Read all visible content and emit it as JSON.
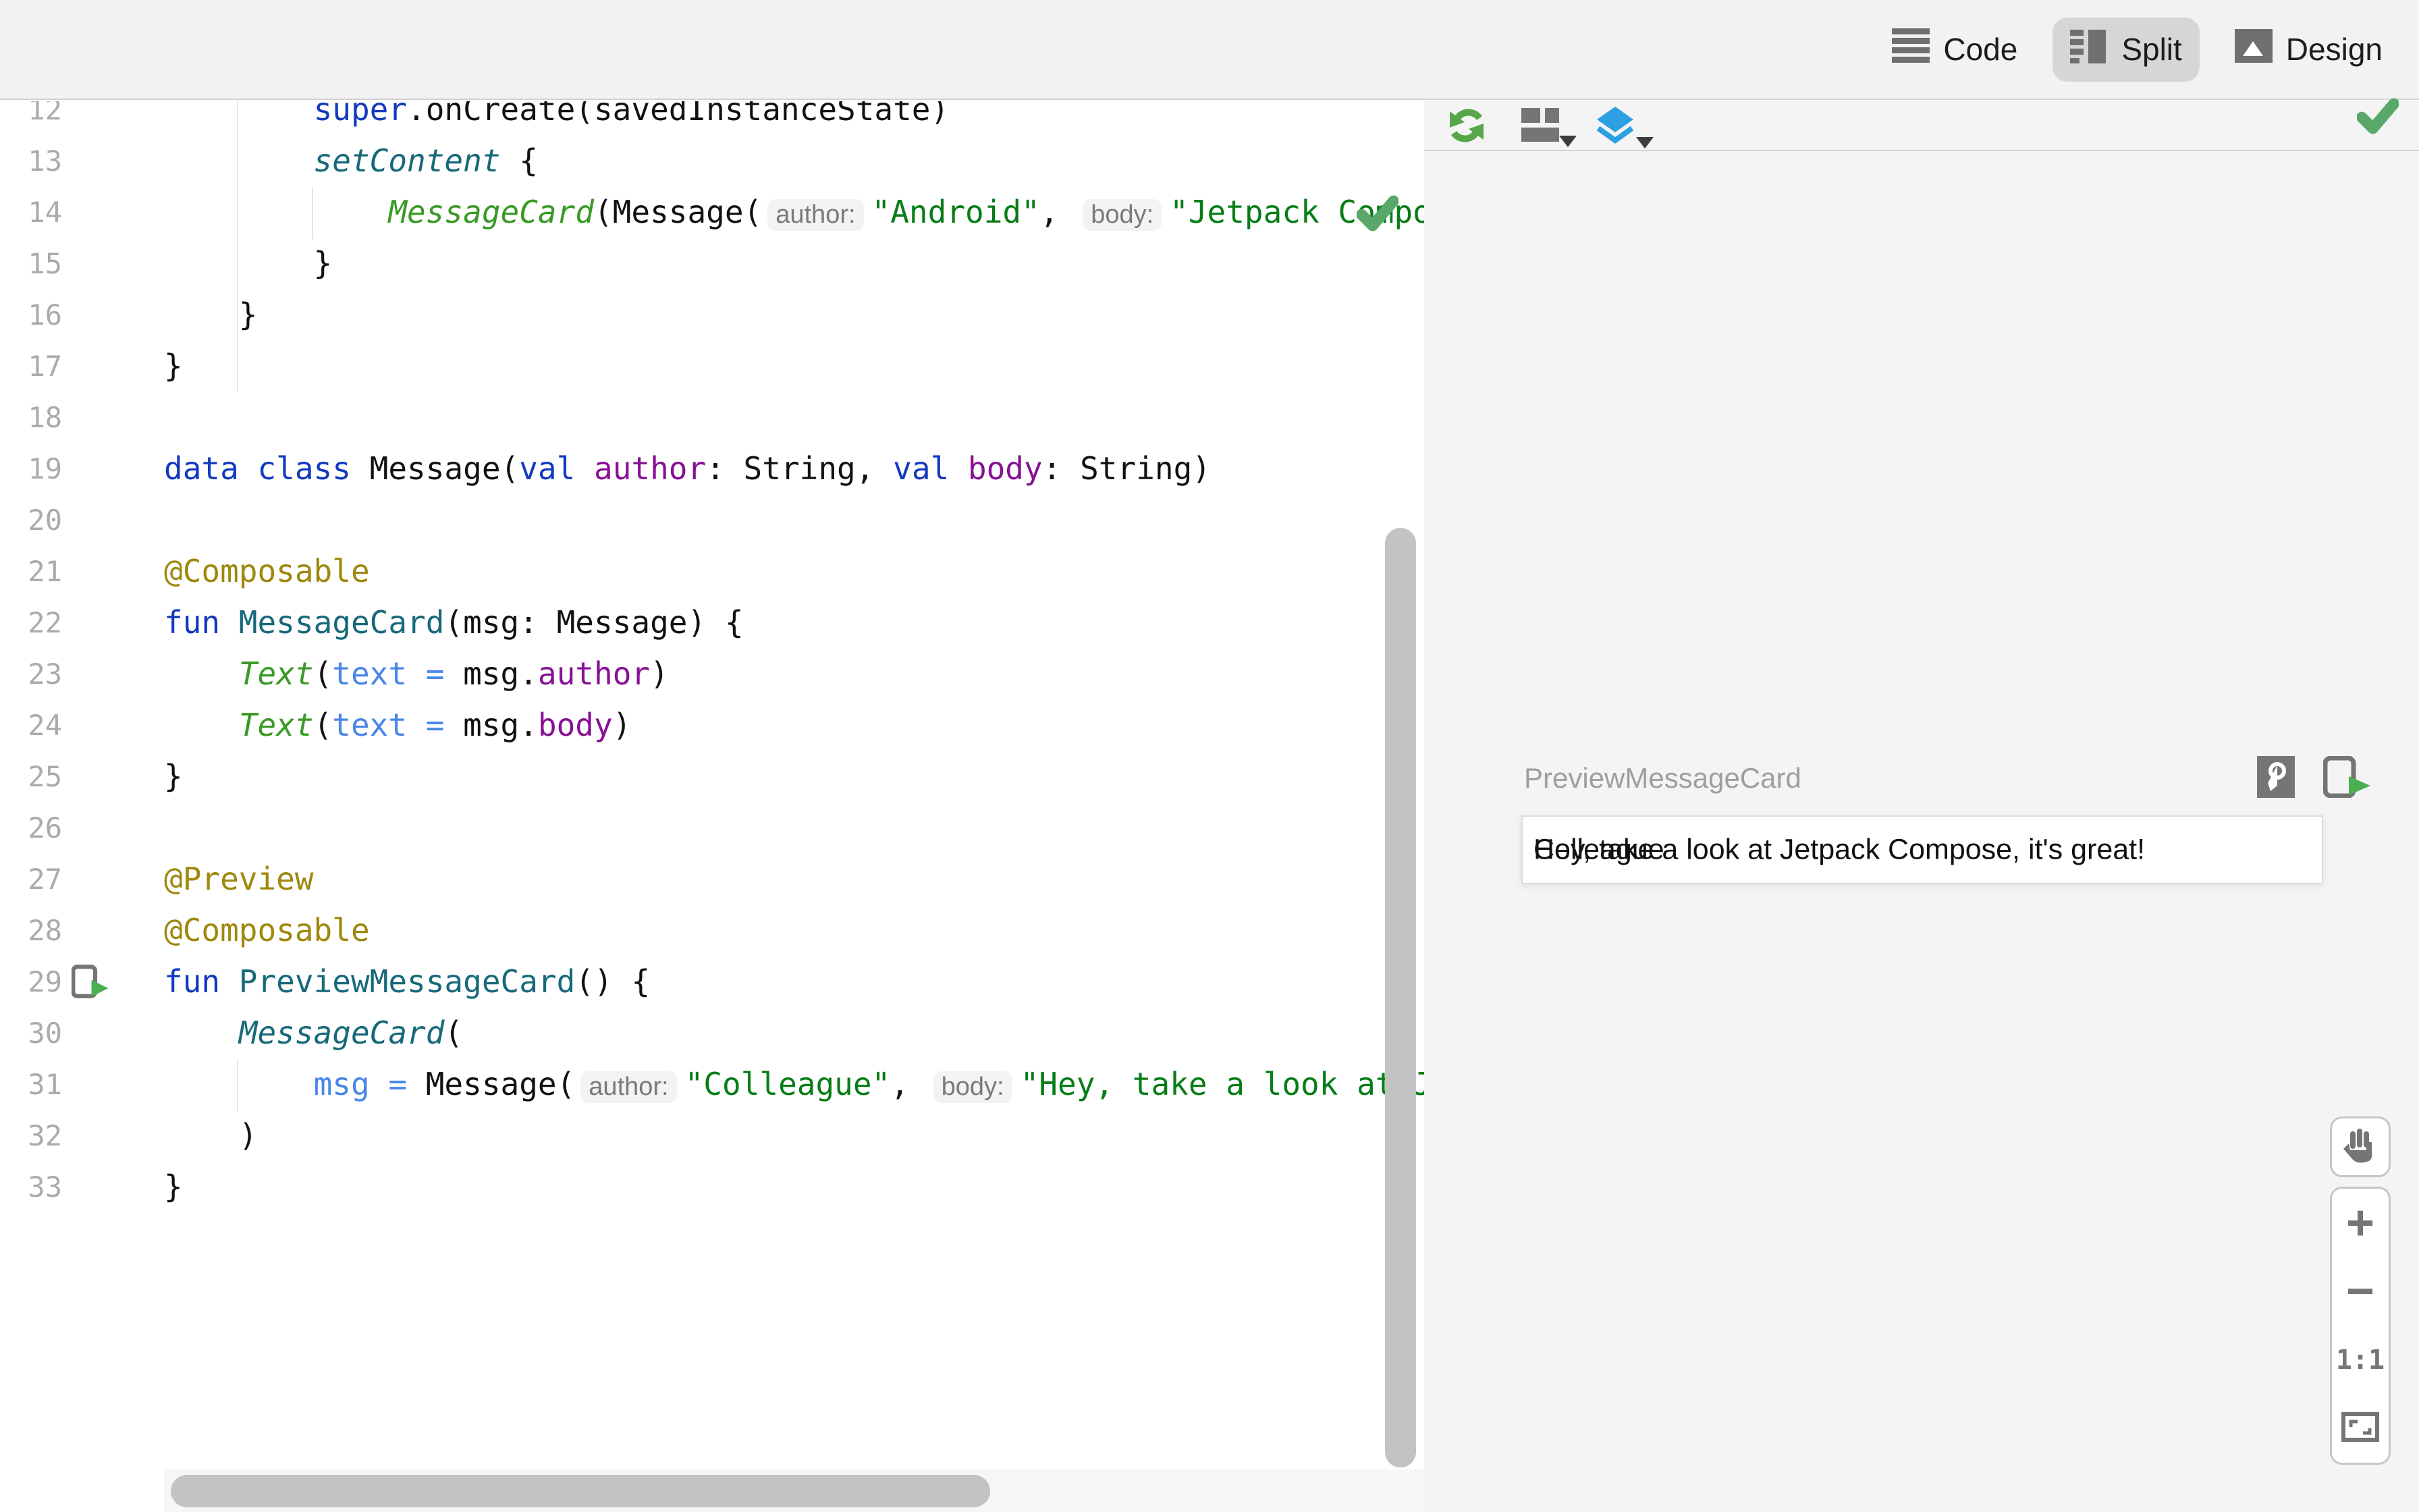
{
  "topbar": {
    "modes": [
      {
        "label": "Code",
        "icon": "code-view-icon",
        "active": false
      },
      {
        "label": "Split",
        "icon": "split-view-icon",
        "active": true
      },
      {
        "label": "Design",
        "icon": "design-view-icon",
        "active": false
      }
    ]
  },
  "editor": {
    "status_icon": "no-problems-check-icon",
    "lines": [
      {
        "n": 12,
        "tokens": [
          {
            "c": "pl",
            "t": "        "
          },
          {
            "c": "kw",
            "t": "super"
          },
          {
            "c": "pl",
            "t": ".onCreate(savedInstanceState)"
          }
        ]
      },
      {
        "n": 13,
        "tokens": [
          {
            "c": "pl",
            "t": "        "
          },
          {
            "c": "fni",
            "t": "setContent"
          },
          {
            "c": "pl",
            "t": " {"
          }
        ]
      },
      {
        "n": 14,
        "tokens": [
          {
            "c": "pl",
            "t": "            "
          },
          {
            "c": "comp",
            "t": "MessageCard"
          },
          {
            "c": "pl",
            "t": "(Message("
          },
          {
            "c": "hint",
            "t": "author:"
          },
          {
            "c": "str",
            "t": "\"Android\""
          },
          {
            "c": "pl",
            "t": ", "
          },
          {
            "c": "hint",
            "t": "body:"
          },
          {
            "c": "str",
            "t": "\"Jetpack Compose\""
          }
        ]
      },
      {
        "n": 15,
        "tokens": [
          {
            "c": "pl",
            "t": "        }"
          }
        ]
      },
      {
        "n": 16,
        "tokens": [
          {
            "c": "pl",
            "t": "    }"
          }
        ]
      },
      {
        "n": 17,
        "tokens": [
          {
            "c": "pl",
            "t": "}"
          }
        ]
      },
      {
        "n": 18,
        "tokens": []
      },
      {
        "n": 19,
        "tokens": [
          {
            "c": "kw",
            "t": "data class"
          },
          {
            "c": "pl",
            "t": " Message("
          },
          {
            "c": "kw",
            "t": "val"
          },
          {
            "c": "pl",
            "t": " "
          },
          {
            "c": "prop",
            "t": "author"
          },
          {
            "c": "pl",
            "t": ": String, "
          },
          {
            "c": "kw",
            "t": "val"
          },
          {
            "c": "pl",
            "t": " "
          },
          {
            "c": "prop",
            "t": "body"
          },
          {
            "c": "pl",
            "t": ": String)"
          }
        ]
      },
      {
        "n": 20,
        "tokens": []
      },
      {
        "n": 21,
        "tokens": [
          {
            "c": "ann",
            "t": "@Composable"
          }
        ]
      },
      {
        "n": 22,
        "tokens": [
          {
            "c": "kw",
            "t": "fun"
          },
          {
            "c": "pl",
            "t": " "
          },
          {
            "c": "fn",
            "t": "MessageCard"
          },
          {
            "c": "pl",
            "t": "(msg: Message) {"
          }
        ]
      },
      {
        "n": 23,
        "tokens": [
          {
            "c": "pl",
            "t": "    "
          },
          {
            "c": "comp",
            "t": "Text"
          },
          {
            "c": "pl",
            "t": "("
          },
          {
            "c": "named",
            "t": "text = "
          },
          {
            "c": "pl",
            "t": "msg."
          },
          {
            "c": "prop",
            "t": "author"
          },
          {
            "c": "pl",
            "t": ")"
          }
        ]
      },
      {
        "n": 24,
        "tokens": [
          {
            "c": "pl",
            "t": "    "
          },
          {
            "c": "comp",
            "t": "Text"
          },
          {
            "c": "pl",
            "t": "("
          },
          {
            "c": "named",
            "t": "text = "
          },
          {
            "c": "pl",
            "t": "msg."
          },
          {
            "c": "prop",
            "t": "body"
          },
          {
            "c": "pl",
            "t": ")"
          }
        ]
      },
      {
        "n": 25,
        "tokens": [
          {
            "c": "pl",
            "t": "}"
          }
        ]
      },
      {
        "n": 26,
        "tokens": []
      },
      {
        "n": 27,
        "tokens": [
          {
            "c": "ann",
            "t": "@Preview"
          }
        ]
      },
      {
        "n": 28,
        "tokens": [
          {
            "c": "ann",
            "t": "@Composable"
          }
        ]
      },
      {
        "n": 29,
        "icon": "run-preview-icon",
        "tokens": [
          {
            "c": "kw",
            "t": "fun"
          },
          {
            "c": "pl",
            "t": " "
          },
          {
            "c": "fn",
            "t": "PreviewMessageCard"
          },
          {
            "c": "pl",
            "t": "() {"
          }
        ]
      },
      {
        "n": 30,
        "tokens": [
          {
            "c": "pl",
            "t": "    "
          },
          {
            "c": "fni",
            "t": "MessageCard"
          },
          {
            "c": "pl",
            "t": "("
          }
        ]
      },
      {
        "n": 31,
        "tokens": [
          {
            "c": "pl",
            "t": "        "
          },
          {
            "c": "named",
            "t": "msg = "
          },
          {
            "c": "pl",
            "t": "Message("
          },
          {
            "c": "hint",
            "t": "author:"
          },
          {
            "c": "str",
            "t": "\"Colleague\""
          },
          {
            "c": "pl",
            "t": ", "
          },
          {
            "c": "hint",
            "t": "body:"
          },
          {
            "c": "str",
            "t": "\"Hey, take a look at Jetpack Compose, it's great!\""
          }
        ]
      },
      {
        "n": 32,
        "tokens": [
          {
            "c": "pl",
            "t": "    )"
          }
        ]
      },
      {
        "n": 33,
        "tokens": [
          {
            "c": "pl",
            "t": "}"
          }
        ]
      }
    ]
  },
  "preview": {
    "toolbar_icons": [
      "refresh-icon",
      "layout-variants-icon",
      "layers-icon",
      "render-ok-check-icon"
    ],
    "title": "PreviewMessageCard",
    "title_icons": [
      "interactive-preview-icon",
      "run-preview-icon"
    ],
    "card": {
      "author": "Colleague",
      "body": "Hey, take a look at Jetpack Compose, it's great!"
    },
    "controls": {
      "pan_icon": "hand-pan-icon",
      "zoom_in": "+",
      "zoom_out": "−",
      "actual_size": "1:1",
      "fit_icon": "zoom-to-fit-icon"
    }
  },
  "colors": {
    "accent_green": "#57a64a",
    "accent_blue": "#2d9fe3",
    "check_green": "#59a869",
    "keyword": "#1239be",
    "string": "#067d17",
    "composable_call": "#3a9a26",
    "function_decl": "#17697a",
    "property": "#871094",
    "named_argument": "#4a86e8",
    "annotation": "#9e880d"
  }
}
